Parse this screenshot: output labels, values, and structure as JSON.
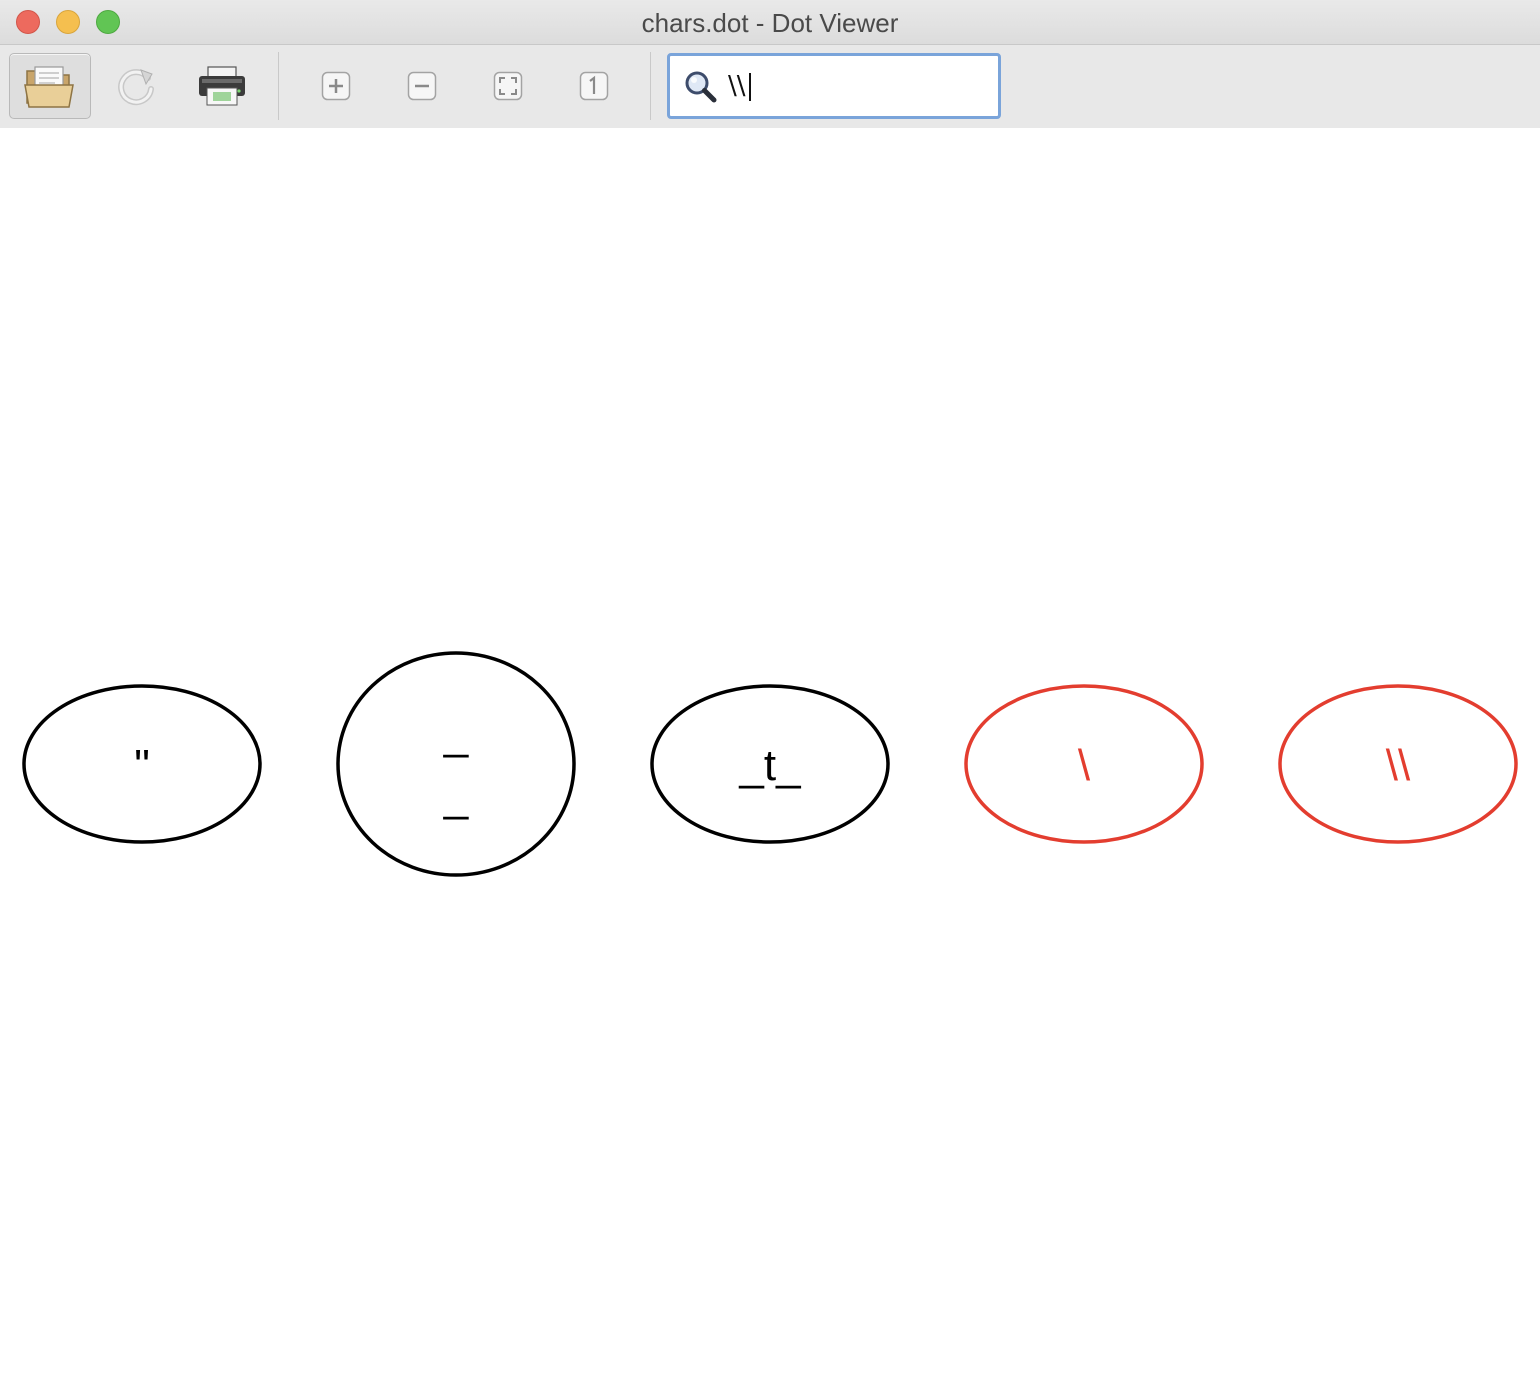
{
  "window": {
    "title": "chars.dot - Dot Viewer"
  },
  "toolbar": {
    "buttons": [
      {
        "name": "open",
        "icon": "folder-open-icon",
        "active": true
      },
      {
        "name": "reload",
        "icon": "reload-icon"
      },
      {
        "name": "print",
        "icon": "printer-icon"
      },
      {
        "name": "zoom-in",
        "icon": "zoom-in-icon"
      },
      {
        "name": "zoom-out",
        "icon": "zoom-out-icon"
      },
      {
        "name": "zoom-fit",
        "icon": "zoom-fit-icon"
      },
      {
        "name": "zoom-100",
        "icon": "zoom-actual-size-icon"
      }
    ],
    "search": {
      "value": "\\\\",
      "icon": "magnifier-icon"
    }
  },
  "graph": {
    "nodes": [
      {
        "label": "\"",
        "lines": [
          "\""
        ],
        "color": "#000000",
        "highlighted": false
      },
      {
        "label": "_ _",
        "lines": [
          "_",
          "_"
        ],
        "color": "#000000",
        "highlighted": false
      },
      {
        "label": "_t_",
        "lines": [
          "_t_"
        ],
        "color": "#000000",
        "highlighted": false
      },
      {
        "label": "\\",
        "lines": [
          "\\"
        ],
        "color": "#e33d2f",
        "highlighted": true
      },
      {
        "label": "\\\\",
        "lines": [
          "\\\\"
        ],
        "color": "#e33d2f",
        "highlighted": true
      }
    ]
  },
  "colors": {
    "highlight": "#e33d2f",
    "node_stroke": "#000000",
    "search_focus": "#7aa4da"
  }
}
